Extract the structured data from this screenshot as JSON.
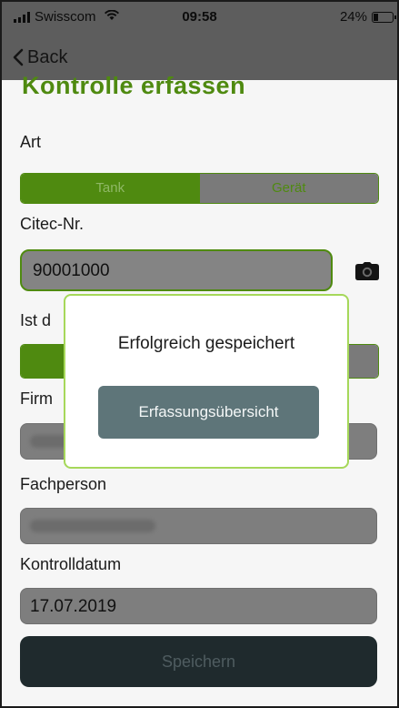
{
  "status_bar": {
    "carrier": "Swisscom",
    "time": "09:58",
    "battery_text": "24%",
    "battery_level": 0.24
  },
  "nav": {
    "back_label": "Back"
  },
  "page": {
    "title": "Kontrolle erfassen",
    "art_label": "Art",
    "art_options": [
      "Tank",
      "Gerät"
    ],
    "art_selected": "Tank",
    "citec_label": "Citec-Nr.",
    "citec_value": "90001000",
    "ist_label": "Ist d",
    "firma_label": "Firm",
    "fachperson_label": "Fachperson",
    "kontrolldatum_label": "Kontrolldatum",
    "kontrolldatum_value": "17.07.2019",
    "save_label": "Speichern"
  },
  "modal": {
    "message": "Erfolgreich gespeichert",
    "button_label": "Erfassungsübersicht"
  },
  "colors": {
    "accent_green": "#4f8a10",
    "modal_border": "#a6d85a",
    "modal_button": "#5e7579"
  }
}
